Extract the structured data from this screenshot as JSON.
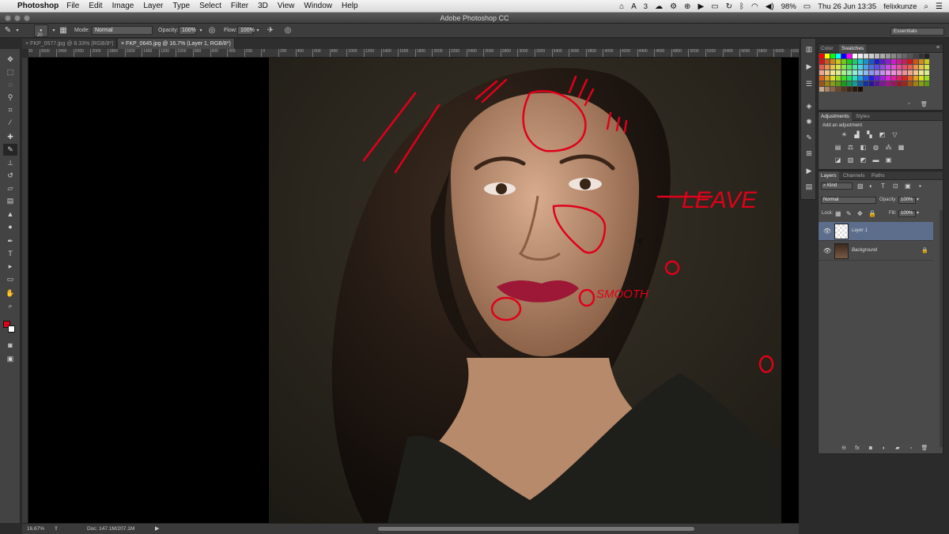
{
  "menubar": {
    "app": "Photoshop",
    "items": [
      "File",
      "Edit",
      "Image",
      "Layer",
      "Type",
      "Select",
      "Filter",
      "3D",
      "View",
      "Window",
      "Help"
    ],
    "status": {
      "adobe_count": "3",
      "battery": "98%",
      "datetime": "Thu 26 Jun  13:35",
      "user": "felixkunze"
    }
  },
  "window": {
    "title": "Adobe Photoshop CC"
  },
  "options": {
    "brush_size": "20",
    "mode_label": "Mode:",
    "mode_value": "Normal",
    "opacity_label": "Opacity:",
    "opacity_value": "100%",
    "flow_label": "Flow:",
    "flow_value": "100%",
    "workspace": "Essentials"
  },
  "tabs": [
    {
      "label": "FKP_0577.jpg @ 8.33% (RGB/8*)",
      "active": false
    },
    {
      "label": "FKP_0645.jpg @ 16.7% (Layer 1, RGB/8*)",
      "active": true
    }
  ],
  "ruler": {
    "ticks": [
      "2800",
      "2600",
      "2400",
      "2200",
      "2000",
      "1800",
      "1600",
      "1400",
      "1200",
      "1000",
      "800",
      "600",
      "400",
      "200",
      "0",
      "200",
      "400",
      "600",
      "800",
      "1000",
      "1200",
      "1400",
      "1600",
      "1800",
      "2000",
      "2200",
      "2400",
      "2600",
      "2800",
      "3000",
      "3200",
      "3400",
      "3600",
      "3800",
      "4000",
      "4200",
      "4400",
      "4600",
      "4800",
      "5000",
      "5200",
      "5400",
      "5600",
      "5800",
      "6000",
      "6200"
    ]
  },
  "annotations": {
    "leave": "LEAVE",
    "smooth": "SMOOTH"
  },
  "colors": {
    "annotation": "#e0001a",
    "foreground": "#e0001a",
    "background_swatch": "#ffffff",
    "selected_layer": "#5c6e8c"
  },
  "status": {
    "zoom": "16.67%",
    "doc": "Doc: 147.1M/207.1M"
  },
  "panels": {
    "color_tabs": [
      "Color",
      "Swatches"
    ],
    "adjust_tabs": [
      "Adjustments",
      "Styles"
    ],
    "add_adjustment": "Add an adjustment",
    "layers_tabs": [
      "Layers",
      "Channels",
      "Paths"
    ],
    "kind": "Kind",
    "blend_mode": "Normal",
    "opacity_label": "Opacity:",
    "opacity": "100%",
    "lock_label": "Lock:",
    "fill_label": "Fill:",
    "fill": "100%",
    "layers": [
      {
        "name": "Layer 1",
        "selected": true
      },
      {
        "name": "Background",
        "selected": false
      }
    ]
  }
}
